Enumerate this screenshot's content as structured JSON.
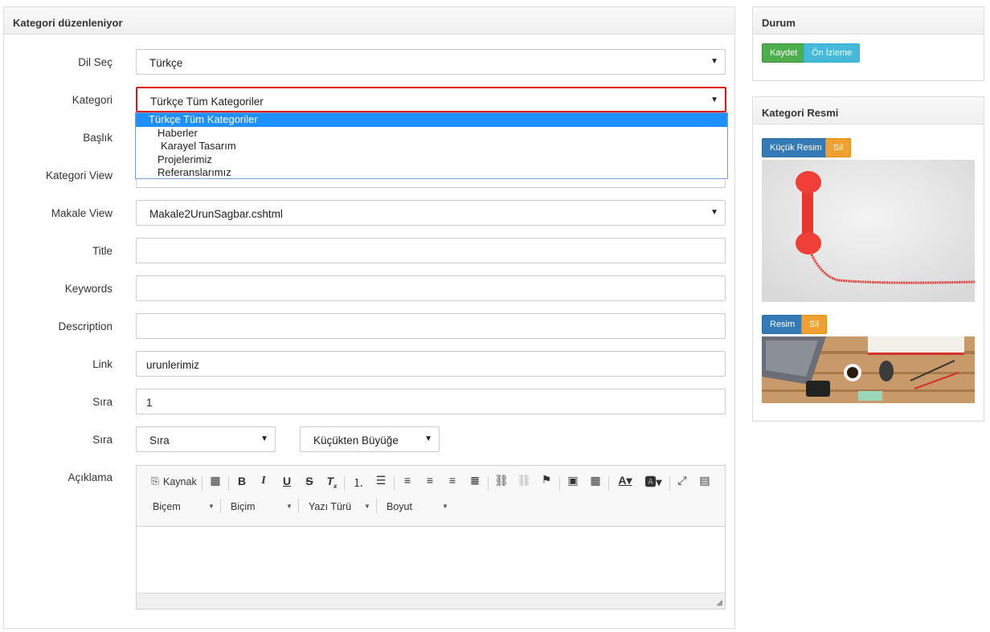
{
  "main": {
    "title": "Kategori düzenleniyor",
    "fields": {
      "dil": {
        "label": "Dil Seç",
        "value": "Türkçe"
      },
      "kategori": {
        "label": "Kategori",
        "value": "Türkçe Tüm Kategoriler"
      },
      "baslik": {
        "label": "Başlık"
      },
      "kategori_view": {
        "label": "Kategori View"
      },
      "makale_view": {
        "label": "Makale View",
        "value": "Makale2UrunSagbar.cshtml"
      },
      "title": {
        "label": "Title",
        "value": ""
      },
      "keywords": {
        "label": "Keywords",
        "value": ""
      },
      "description": {
        "label": "Description",
        "value": ""
      },
      "link": {
        "label": "Link",
        "value": "urunlerimiz"
      },
      "sira1": {
        "label": "Sıra",
        "value": "1"
      },
      "sira2": {
        "label": "Sıra",
        "value": "Sıra",
        "order": "Küçükten Büyüğe"
      },
      "aciklama": {
        "label": "Açıklama"
      }
    },
    "kategori_options": [
      "Türkçe Tüm Kategoriler",
      "Haberler",
      "Karayel Tasarım",
      "Projelerimiz",
      "Referanslarımız"
    ],
    "editor": {
      "source_label": "Kaynak",
      "combo1": "Biçem",
      "combo2": "Biçim",
      "combo3": "Yazı Türü",
      "combo4": "Boyut",
      "icons": [
        "source-icon",
        "templates-icon",
        "bold-icon",
        "italic-icon",
        "underline-icon",
        "strike-icon",
        "remove-format-icon",
        "numbered-list-icon",
        "bulleted-list-icon",
        "align-left-icon",
        "align-center-icon",
        "align-right-icon",
        "justify-icon",
        "link-icon",
        "unlink-icon",
        "anchor-icon",
        "image-icon",
        "table-icon",
        "text-color-icon",
        "bg-color-icon",
        "maximize-icon",
        "show-blocks-icon"
      ]
    }
  },
  "durum": {
    "title": "Durum",
    "save_label": "Kaydet",
    "preview_label": "Ön İzleme"
  },
  "resim": {
    "title": "Kategori Resmi",
    "small_label": "Küçük Resim",
    "delete_label": "Sil",
    "large_label": "Resim",
    "delete2_label": "Sil"
  },
  "colors": {
    "highlight": "#e0161b",
    "selected": "#1e90ff",
    "green": "#4cae4c",
    "cyan": "#46b8da",
    "blue": "#337ab7",
    "orange": "#f0a030"
  }
}
